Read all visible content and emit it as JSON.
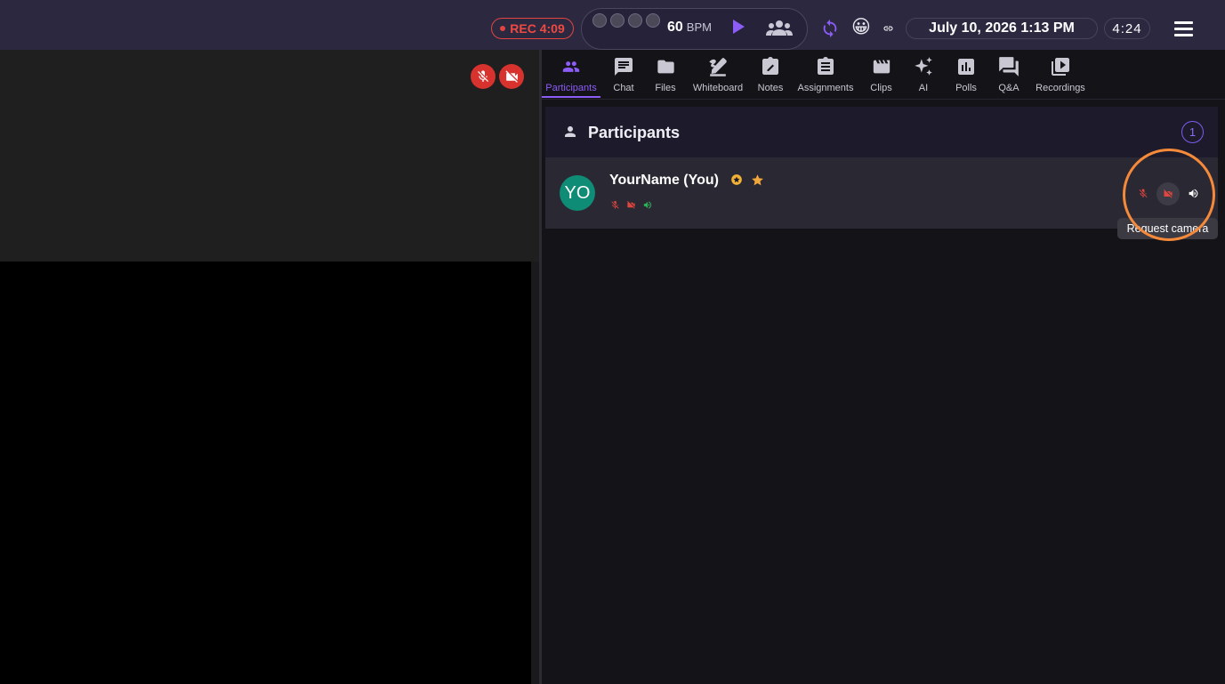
{
  "topbar": {
    "rec_label": "REC 4:09",
    "bpm_value": "60",
    "bpm_unit": "BPM",
    "date_time": "July 10, 2026 1:13 PM",
    "timer": "4:24",
    "emoji": "😀"
  },
  "tabs": [
    {
      "label": "Participants",
      "icon": "people-icon",
      "active": true
    },
    {
      "label": "Chat",
      "icon": "chat-icon"
    },
    {
      "label": "Files",
      "icon": "folder-icon"
    },
    {
      "label": "Whiteboard",
      "icon": "draw-icon"
    },
    {
      "label": "Notes",
      "icon": "note-edit-icon"
    },
    {
      "label": "Assignments",
      "icon": "clipboard-icon"
    },
    {
      "label": "Clips",
      "icon": "clapper-icon"
    },
    {
      "label": "AI",
      "icon": "sparkle-icon"
    },
    {
      "label": "Polls",
      "icon": "poll-icon"
    },
    {
      "label": "Q&A",
      "icon": "forum-icon"
    },
    {
      "label": "Recordings",
      "icon": "video-library-icon"
    }
  ],
  "participants": {
    "title": "Participants",
    "count": "1",
    "items": [
      {
        "initials": "YO",
        "name": "YourName (You)",
        "avatar_color": "#0f8c76"
      }
    ]
  },
  "tooltip": "Request camera",
  "colors": {
    "accent": "#8b5cf6",
    "danger": "#d7322d",
    "highlight": "#f58a3a",
    "topbar": "#2b2840"
  }
}
